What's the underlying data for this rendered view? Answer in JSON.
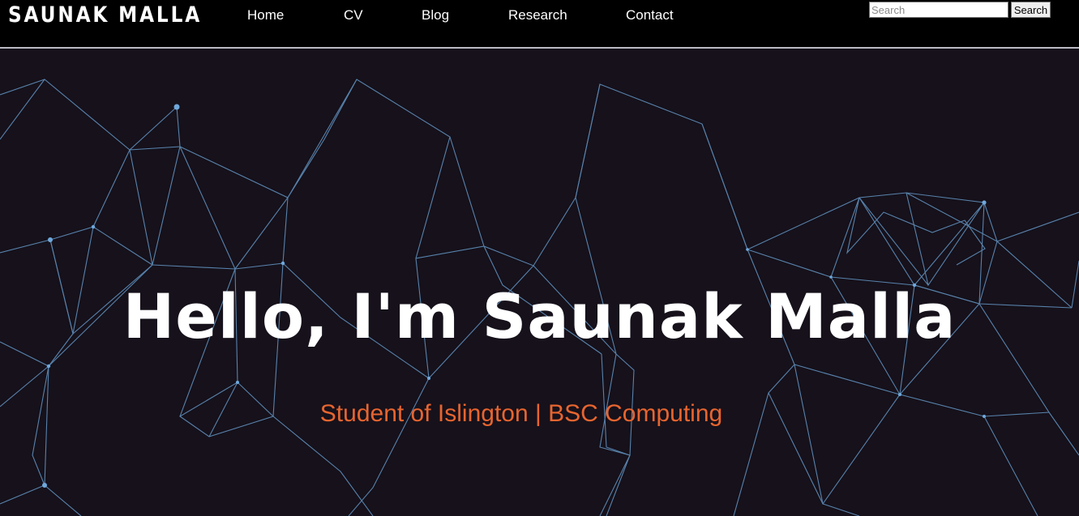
{
  "brand": {
    "name": "SAUNAK MALLA"
  },
  "nav": {
    "items": [
      {
        "label": "Home"
      },
      {
        "label": "CV"
      },
      {
        "label": "Blog"
      },
      {
        "label": "Research"
      },
      {
        "label": "Contact"
      }
    ]
  },
  "search": {
    "placeholder": "Search",
    "value": "",
    "button_label": "Search"
  },
  "hero": {
    "title": "Hello, I'm Saunak Malla",
    "subtitle": "Student of Islington | BSC Computing",
    "background_icon": "network-lines-background"
  },
  "colors": {
    "nav_background": "#000000",
    "hero_background": "#16111b",
    "network_lines": "#6fa8dc",
    "subtitle": "#e8652f",
    "title": "#ffffff"
  }
}
